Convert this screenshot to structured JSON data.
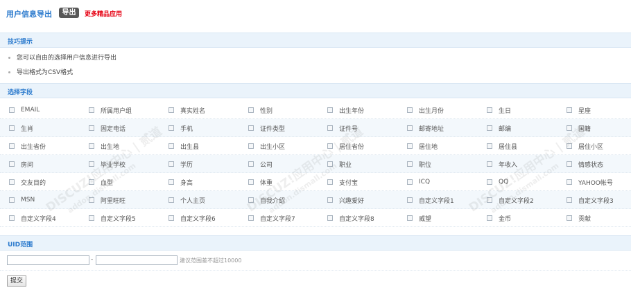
{
  "header": {
    "title": "用户信息导出",
    "export_label": "导出",
    "more_apps_label": "更多精品应用"
  },
  "tips": {
    "heading": "技巧提示",
    "items": [
      "您可以自由的选择用户信息进行导出",
      "导出格式为CSV格式"
    ]
  },
  "fields": {
    "heading": "选择字段",
    "rows": [
      [
        "EMAIL",
        "所属用户组",
        "真实姓名",
        "性别",
        "出生年份",
        "出生月份",
        "生日",
        "星座"
      ],
      [
        "生肖",
        "固定电话",
        "手机",
        "证件类型",
        "证件号",
        "邮寄地址",
        "邮编",
        "国籍"
      ],
      [
        "出生省份",
        "出生地",
        "出生县",
        "出生小区",
        "居住省份",
        "居住地",
        "居住县",
        "居住小区"
      ],
      [
        "房间",
        "毕业学校",
        "学历",
        "公司",
        "职业",
        "职位",
        "年收入",
        "情感状态"
      ],
      [
        "交友目的",
        "血型",
        "身高",
        "体重",
        "支付宝",
        "ICQ",
        "QQ",
        "YAHOO帐号"
      ],
      [
        "MSN",
        "阿里旺旺",
        "个人主页",
        "自我介绍",
        "兴趣爱好",
        "自定义字段1",
        "自定义字段2",
        "自定义字段3"
      ],
      [
        "自定义字段4",
        "自定义字段5",
        "自定义字段6",
        "自定义字段7",
        "自定义字段8",
        "威望",
        "金币",
        "贡献"
      ]
    ]
  },
  "uid_range": {
    "heading": "UID范围",
    "from_value": "",
    "to_value": "",
    "separator": "-",
    "hint": "建议范围差不超过10000"
  },
  "submit_label": "提交",
  "watermark": {
    "text": "DISCUZ!应用中心 | 贰道",
    "sub": "addon.dismall.com"
  }
}
